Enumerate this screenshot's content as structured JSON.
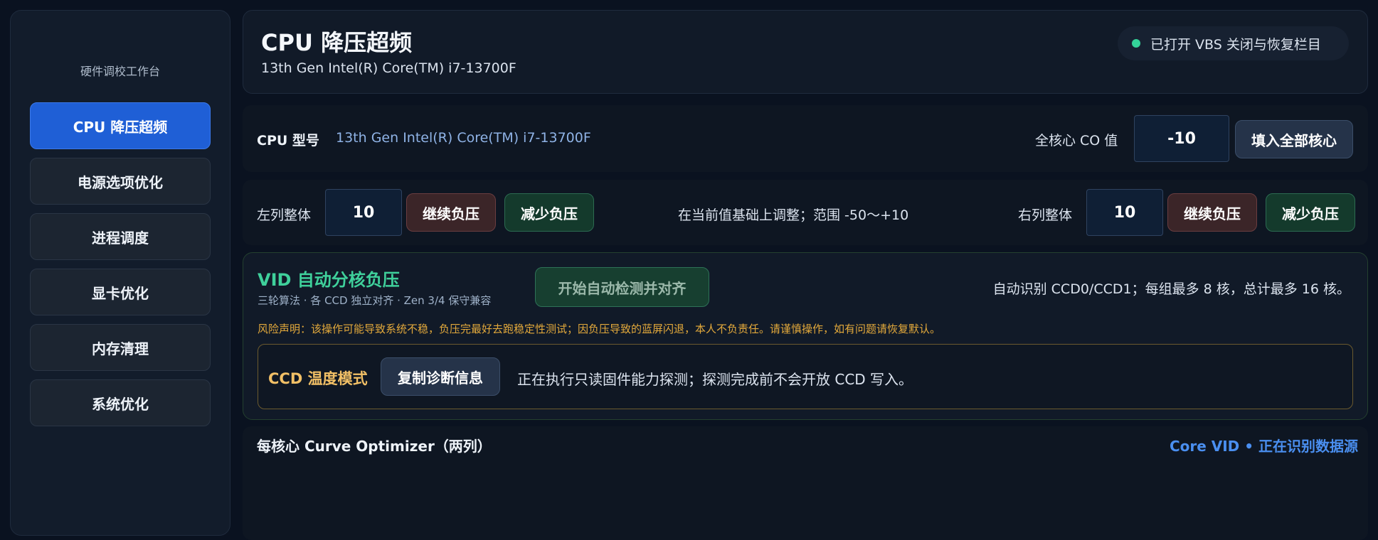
{
  "sidebar": {
    "brand": "硬件调校工作台",
    "items": [
      {
        "label": "CPU 降压超频",
        "active": true
      },
      {
        "label": "电源选项优化"
      },
      {
        "label": "进程调度"
      },
      {
        "label": "显卡优化"
      },
      {
        "label": "内存清理"
      },
      {
        "label": "系统优化"
      }
    ]
  },
  "header": {
    "title": "CPU 降压超频",
    "subtitle": "13th Gen Intel(R) Core(TM) i7-13700F",
    "vbs_status": "已打开 VBS 关闭与恢复栏目",
    "vbs_dot_color": "#34d399"
  },
  "cpu_row": {
    "model_label": "CPU 型号",
    "model_value": "13th Gen Intel(R) Core(TM) i7-13700F",
    "co_label": "全核心 CO 值",
    "co_value": "-10",
    "fill_all_button": "填入全部核心"
  },
  "adjust_row": {
    "left_label": "左列整体",
    "left_value": "10",
    "continue_button": "继续负压",
    "reduce_button": "减少负压",
    "hint": "在当前值基础上调整；范围 -50～+10",
    "right_label": "右列整体",
    "right_value": "10"
  },
  "vid": {
    "title": "VID 自动分核负压",
    "subtitle": "三轮算法 · 各 CCD 独立对齐 · Zen 3/4 保守兼容",
    "start_button": "开始自动检测并对齐",
    "auto_detect_info": "自动识别 CCD0/CCD1；每组最多 8 核，总计最多 16 核。",
    "risk_notice": "风险声明：该操作可能导致系统不稳，负压完最好去跑稳定性测试；因负压导致的蓝屏闪退，本人不负责任。请谨慎操作，如有问题请恢复默认。",
    "ccd_mode_label": "CCD 温度模式",
    "copy_diag_button": "复制诊断信息",
    "ccd_status": "正在执行只读固件能力探测；探测完成前不会开放 CCD 写入。"
  },
  "curve": {
    "title": "每核心 Curve Optimizer（两列）",
    "status": "Core VID • 正在识别数据源"
  },
  "colors": {
    "accent_blue": "#1f5fd6",
    "accent_green": "#3fd09b",
    "warning_orange": "#e3a93b",
    "ccd_gold": "#f2c066"
  }
}
